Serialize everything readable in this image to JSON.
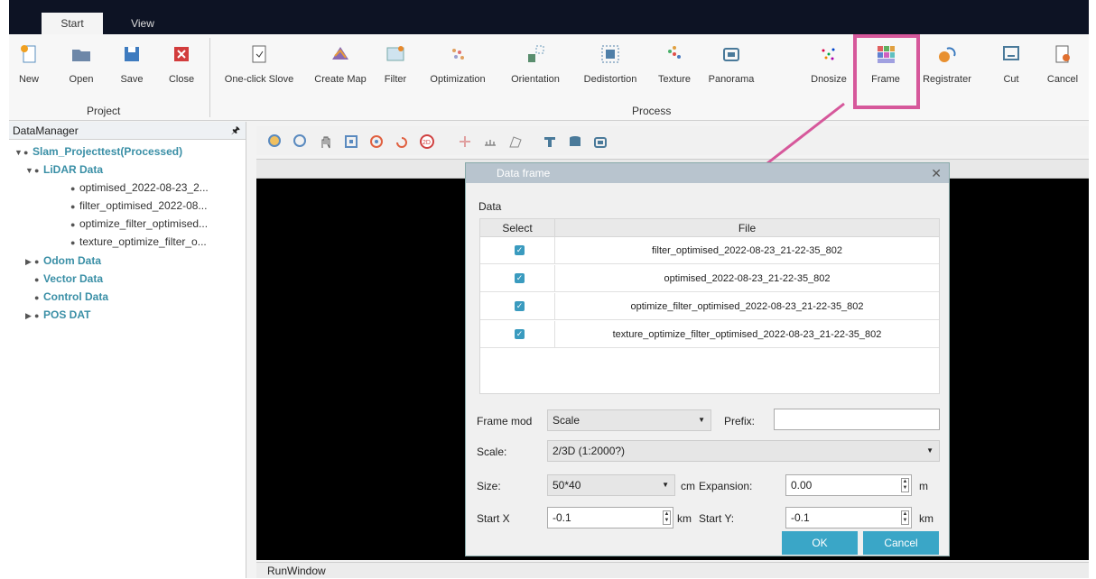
{
  "tabs": [
    {
      "label": "Start"
    },
    {
      "label": "View"
    }
  ],
  "ribbon": {
    "project_buttons": [
      {
        "label": "New",
        "icon": "new-file-icon"
      },
      {
        "label": "Open",
        "icon": "folder-open-icon"
      },
      {
        "label": "Save",
        "icon": "save-icon"
      },
      {
        "label": "Close",
        "icon": "close-icon"
      }
    ],
    "project_group": "Project",
    "process_buttons": [
      {
        "label": "One-click Slove",
        "icon": "one-click-icon"
      },
      {
        "label": "Create Map",
        "icon": "map-icon"
      },
      {
        "label": "Filter",
        "icon": "filter-icon"
      },
      {
        "label": "Optimization",
        "icon": "optimization-icon"
      },
      {
        "label": "Orientation",
        "icon": "orientation-icon"
      },
      {
        "label": "Dedistortion",
        "icon": "dedistortion-icon"
      },
      {
        "label": "Texture",
        "icon": "texture-icon"
      },
      {
        "label": "Panorama",
        "icon": "panorama-icon"
      },
      {
        "label": "Dnosize",
        "icon": "denoise-icon"
      },
      {
        "label": "Frame",
        "icon": "frame-icon"
      },
      {
        "label": "Registrater",
        "icon": "registration-icon"
      },
      {
        "label": "Cut",
        "icon": "cut-icon"
      },
      {
        "label": "Cancel",
        "icon": "cancel-icon"
      }
    ],
    "process_group": "Process"
  },
  "data_manager": {
    "title": "DataManager",
    "root": "Slam_Projecttest(Processed)",
    "lidar": "LiDAR Data",
    "lidar_items": [
      "optimised_2022-08-23_2...",
      "filter_optimised_2022-08...",
      "optimize_filter_optimised...",
      "texture_optimize_filter_o..."
    ],
    "others": [
      "Odom Data",
      "Vector Data",
      "Control Data",
      "POS DAT"
    ]
  },
  "run_window": "RunWindow",
  "dialog": {
    "title": "Data frame",
    "section": "Data",
    "col_select": "Select",
    "col_file": "File",
    "files": [
      "filter_optimised_2022-08-23_21-22-35_802",
      "optimised_2022-08-23_21-22-35_802",
      "optimize_filter_optimised_2022-08-23_21-22-35_802",
      "texture_optimize_filter_optimised_2022-08-23_21-22-35_802"
    ],
    "frame_mod_label": "Frame mod",
    "frame_mod_value": "Scale",
    "prefix_label": "Prefix:",
    "prefix_value": "",
    "scale_label": "Scale:",
    "scale_value": "2/3D (1:2000?)",
    "size_label": "Size:",
    "size_value": "50*40",
    "size_unit": "cm",
    "expansion_label": "Expansion:",
    "expansion_value": "0.00",
    "expansion_unit": "m",
    "startx_label": "Start X",
    "startx_value": "-0.1",
    "startx_unit": "km",
    "starty_label": "Start Y:",
    "starty_value": "-0.1",
    "starty_unit": "km",
    "ok": "OK",
    "cancel": "Cancel"
  }
}
